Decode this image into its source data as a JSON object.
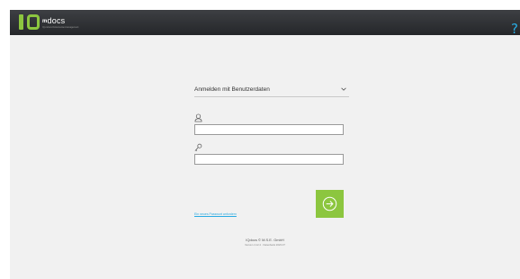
{
  "header": {
    "brand_text": "docs",
    "brand_em": "m",
    "tagline": "IQ-mdocs Dokumentenmanagement",
    "help_symbol": "?",
    "help_icon": "help-icon",
    "accent": "#8cc63f",
    "help_color": "#29abe2"
  },
  "login": {
    "mode_label": "Anmelden mit Benutzerdaten",
    "username_value": "",
    "password_value": "",
    "forgot_link": "Ein neues Passwort anfordern",
    "submit_icon": "arrow-right-circle-icon",
    "submit_color": "#8cc63f"
  },
  "footer": {
    "copyright": "IQdocs © M.S.E. GmbH",
    "version": "Version 4.12.4 · Datenbank 2023.07"
  }
}
